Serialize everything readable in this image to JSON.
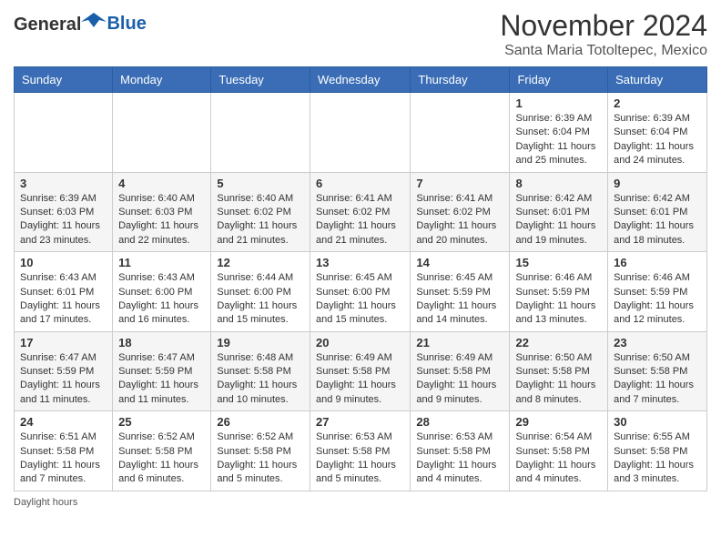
{
  "header": {
    "logo_general": "General",
    "logo_blue": "Blue",
    "month_title": "November 2024",
    "location": "Santa Maria Totoltepec, Mexico"
  },
  "weekdays": [
    "Sunday",
    "Monday",
    "Tuesday",
    "Wednesday",
    "Thursday",
    "Friday",
    "Saturday"
  ],
  "weeks": [
    [
      {
        "day": "",
        "info": ""
      },
      {
        "day": "",
        "info": ""
      },
      {
        "day": "",
        "info": ""
      },
      {
        "day": "",
        "info": ""
      },
      {
        "day": "",
        "info": ""
      },
      {
        "day": "1",
        "info": "Sunrise: 6:39 AM\nSunset: 6:04 PM\nDaylight: 11 hours and 25 minutes."
      },
      {
        "day": "2",
        "info": "Sunrise: 6:39 AM\nSunset: 6:04 PM\nDaylight: 11 hours and 24 minutes."
      }
    ],
    [
      {
        "day": "3",
        "info": "Sunrise: 6:39 AM\nSunset: 6:03 PM\nDaylight: 11 hours and 23 minutes."
      },
      {
        "day": "4",
        "info": "Sunrise: 6:40 AM\nSunset: 6:03 PM\nDaylight: 11 hours and 22 minutes."
      },
      {
        "day": "5",
        "info": "Sunrise: 6:40 AM\nSunset: 6:02 PM\nDaylight: 11 hours and 21 minutes."
      },
      {
        "day": "6",
        "info": "Sunrise: 6:41 AM\nSunset: 6:02 PM\nDaylight: 11 hours and 21 minutes."
      },
      {
        "day": "7",
        "info": "Sunrise: 6:41 AM\nSunset: 6:02 PM\nDaylight: 11 hours and 20 minutes."
      },
      {
        "day": "8",
        "info": "Sunrise: 6:42 AM\nSunset: 6:01 PM\nDaylight: 11 hours and 19 minutes."
      },
      {
        "day": "9",
        "info": "Sunrise: 6:42 AM\nSunset: 6:01 PM\nDaylight: 11 hours and 18 minutes."
      }
    ],
    [
      {
        "day": "10",
        "info": "Sunrise: 6:43 AM\nSunset: 6:01 PM\nDaylight: 11 hours and 17 minutes."
      },
      {
        "day": "11",
        "info": "Sunrise: 6:43 AM\nSunset: 6:00 PM\nDaylight: 11 hours and 16 minutes."
      },
      {
        "day": "12",
        "info": "Sunrise: 6:44 AM\nSunset: 6:00 PM\nDaylight: 11 hours and 15 minutes."
      },
      {
        "day": "13",
        "info": "Sunrise: 6:45 AM\nSunset: 6:00 PM\nDaylight: 11 hours and 15 minutes."
      },
      {
        "day": "14",
        "info": "Sunrise: 6:45 AM\nSunset: 5:59 PM\nDaylight: 11 hours and 14 minutes."
      },
      {
        "day": "15",
        "info": "Sunrise: 6:46 AM\nSunset: 5:59 PM\nDaylight: 11 hours and 13 minutes."
      },
      {
        "day": "16",
        "info": "Sunrise: 6:46 AM\nSunset: 5:59 PM\nDaylight: 11 hours and 12 minutes."
      }
    ],
    [
      {
        "day": "17",
        "info": "Sunrise: 6:47 AM\nSunset: 5:59 PM\nDaylight: 11 hours and 11 minutes."
      },
      {
        "day": "18",
        "info": "Sunrise: 6:47 AM\nSunset: 5:59 PM\nDaylight: 11 hours and 11 minutes."
      },
      {
        "day": "19",
        "info": "Sunrise: 6:48 AM\nSunset: 5:58 PM\nDaylight: 11 hours and 10 minutes."
      },
      {
        "day": "20",
        "info": "Sunrise: 6:49 AM\nSunset: 5:58 PM\nDaylight: 11 hours and 9 minutes."
      },
      {
        "day": "21",
        "info": "Sunrise: 6:49 AM\nSunset: 5:58 PM\nDaylight: 11 hours and 9 minutes."
      },
      {
        "day": "22",
        "info": "Sunrise: 6:50 AM\nSunset: 5:58 PM\nDaylight: 11 hours and 8 minutes."
      },
      {
        "day": "23",
        "info": "Sunrise: 6:50 AM\nSunset: 5:58 PM\nDaylight: 11 hours and 7 minutes."
      }
    ],
    [
      {
        "day": "24",
        "info": "Sunrise: 6:51 AM\nSunset: 5:58 PM\nDaylight: 11 hours and 7 minutes."
      },
      {
        "day": "25",
        "info": "Sunrise: 6:52 AM\nSunset: 5:58 PM\nDaylight: 11 hours and 6 minutes."
      },
      {
        "day": "26",
        "info": "Sunrise: 6:52 AM\nSunset: 5:58 PM\nDaylight: 11 hours and 5 minutes."
      },
      {
        "day": "27",
        "info": "Sunrise: 6:53 AM\nSunset: 5:58 PM\nDaylight: 11 hours and 5 minutes."
      },
      {
        "day": "28",
        "info": "Sunrise: 6:53 AM\nSunset: 5:58 PM\nDaylight: 11 hours and 4 minutes."
      },
      {
        "day": "29",
        "info": "Sunrise: 6:54 AM\nSunset: 5:58 PM\nDaylight: 11 hours and 4 minutes."
      },
      {
        "day": "30",
        "info": "Sunrise: 6:55 AM\nSunset: 5:58 PM\nDaylight: 11 hours and 3 minutes."
      }
    ]
  ],
  "footer": "Daylight hours"
}
